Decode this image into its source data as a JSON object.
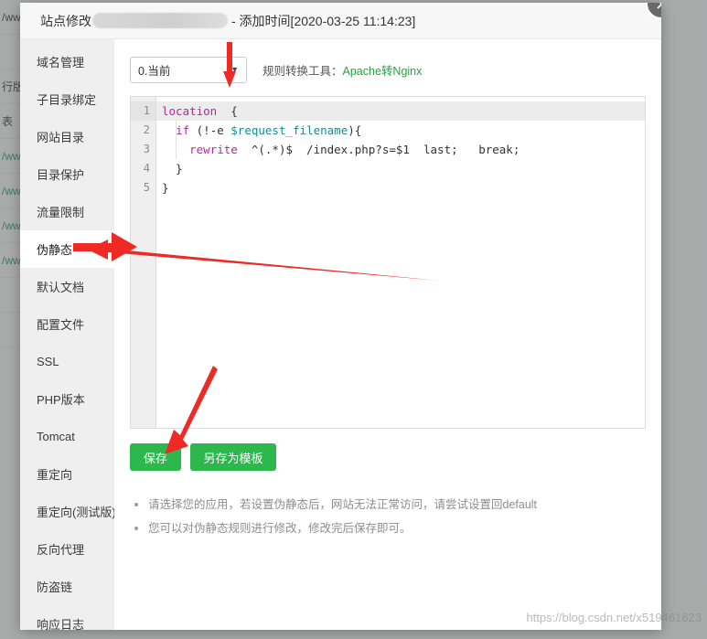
{
  "window": {
    "title_prefix": "站点修改",
    "title_suffix": "- 添加时间[2020-03-25 11:14:23]",
    "close_icon": "close-icon"
  },
  "sidebar": {
    "items": [
      {
        "label": "域名管理",
        "active": false
      },
      {
        "label": "子目录绑定",
        "active": false
      },
      {
        "label": "网站目录",
        "active": false
      },
      {
        "label": "目录保护",
        "active": false
      },
      {
        "label": "流量限制",
        "active": false
      },
      {
        "label": "伪静态",
        "active": true
      },
      {
        "label": "默认文档",
        "active": false
      },
      {
        "label": "配置文件",
        "active": false
      },
      {
        "label": "SSL",
        "active": false
      },
      {
        "label": "PHP版本",
        "active": false
      },
      {
        "label": "Tomcat",
        "active": false
      },
      {
        "label": "重定向",
        "active": false
      },
      {
        "label": "重定向(测试版)",
        "active": false
      },
      {
        "label": "反向代理",
        "active": false
      },
      {
        "label": "防盗链",
        "active": false
      },
      {
        "label": "响应日志",
        "active": false
      }
    ]
  },
  "toolbar": {
    "select_value": "0.当前",
    "select_caret": "chevron-down-icon",
    "converter_label": "规则转换工具：",
    "converter_link": "Apache转Nginx"
  },
  "editor": {
    "line_numbers": [
      "1",
      "2",
      "3",
      "4",
      "5"
    ],
    "lines": [
      {
        "n": "1",
        "current": true,
        "tokens": [
          {
            "t": "location",
            "c": "kw"
          },
          {
            "t": "  {",
            "c": "pln"
          }
        ]
      },
      {
        "n": "2",
        "current": false,
        "tokens": [
          {
            "t": "  ",
            "c": "pln"
          },
          {
            "t": "if",
            "c": "kw"
          },
          {
            "t": " (!-e ",
            "c": "pln"
          },
          {
            "t": "$request_filename",
            "c": "var"
          },
          {
            "t": "){",
            "c": "pln"
          }
        ]
      },
      {
        "n": "3",
        "current": false,
        "tokens": [
          {
            "t": "    ",
            "c": "pln"
          },
          {
            "t": "rewrite",
            "c": "kw"
          },
          {
            "t": "  ^(.*)$  /index.php?s=$1  last;   break;",
            "c": "pln"
          }
        ]
      },
      {
        "n": "4",
        "current": false,
        "tokens": [
          {
            "t": "  }",
            "c": "pln"
          }
        ]
      },
      {
        "n": "5",
        "current": false,
        "tokens": [
          {
            "t": "}",
            "c": "pln"
          }
        ]
      }
    ]
  },
  "buttons": {
    "save": "保存",
    "save_as_template": "另存为模板"
  },
  "notes": [
    "请选择您的应用，若设置伪静态后，网站无法正常访问，请尝试设置回default",
    "您可以对伪静态规则进行修改，修改完后保存即可。"
  ],
  "background": {
    "rows": [
      {
        "text": "/www用",
        "kind": "dark"
      },
      {
        "text": "",
        "kind": "dark"
      },
      {
        "text": "行版本",
        "kind": "dark"
      },
      {
        "text": "表",
        "kind": "dark"
      },
      {
        "text": "/www",
        "kind": "link"
      },
      {
        "text": "/www",
        "kind": "link"
      },
      {
        "text": "/www",
        "kind": "link"
      },
      {
        "text": "/www",
        "kind": "link"
      },
      {
        "text": "",
        "kind": "dark"
      },
      {
        "text": "",
        "kind": "dark"
      }
    ]
  },
  "watermark": "https://blog.csdn.net/x519461623",
  "colors": {
    "accent_green": "#2db84d",
    "link_green": "#20a53a",
    "arrow_red": "#ee2a24",
    "keyword": "#b5289e",
    "variable": "#1a8a9a"
  }
}
